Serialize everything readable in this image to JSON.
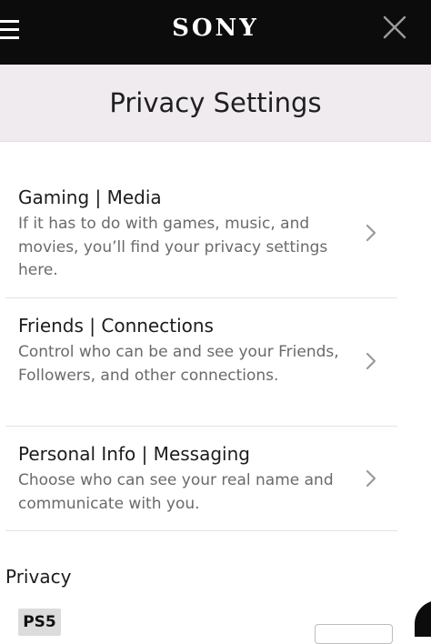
{
  "header": {
    "brand": "SONY",
    "menu_icon": "hamburger-menu-icon",
    "close_icon": "close-x-icon"
  },
  "page": {
    "title": "Privacy Settings"
  },
  "cards": [
    {
      "title": "Gaming | Media",
      "description": "If it has to do with games, music, and movies, you’ll find your privacy settings here.",
      "icon": "chevron-right-icon"
    },
    {
      "title": "Friends | Connections",
      "description": "Control who can be and see your Friends, Followers, and other connections.",
      "icon": "chevron-right-icon"
    },
    {
      "title": "Personal Info | Messaging",
      "description": "Choose who can see your real name and communicate with you.",
      "icon": "chevron-right-icon"
    }
  ],
  "privacy_section": {
    "label": "Privacy",
    "platform_badge": "PS5"
  },
  "colors": {
    "topbar": "#0c0c0c",
    "title_band": "#f0ebef",
    "description_text": "#6a6a6a",
    "chevron": "#9a9a9a"
  }
}
